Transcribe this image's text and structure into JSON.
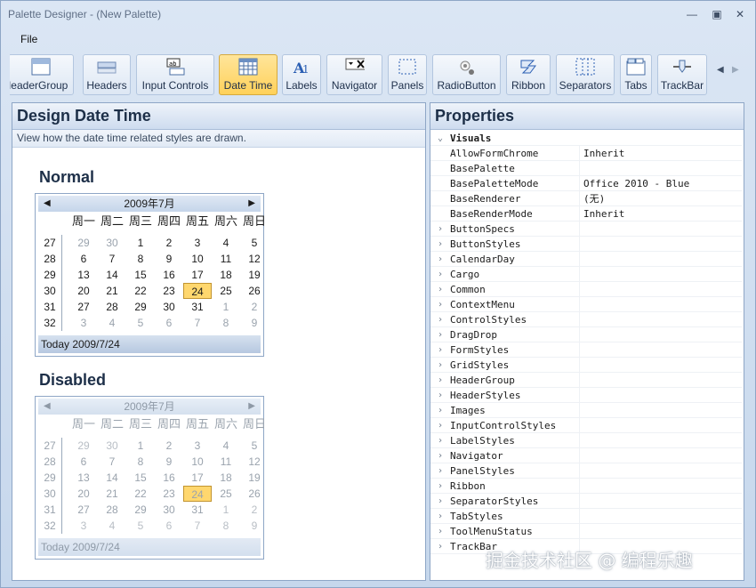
{
  "window": {
    "title": "Palette Designer - (New Palette)",
    "controls": [
      "minimize-icon",
      "restore-icon",
      "close-icon"
    ]
  },
  "menu": {
    "file": "File"
  },
  "toolbar": {
    "buttons": [
      {
        "label": "HeaderGroup",
        "icon": "header-group-icon"
      },
      {
        "label": "Headers",
        "icon": "headers-icon"
      },
      {
        "label": "Input Controls",
        "icon": "input-controls-icon"
      },
      {
        "label": "Date Time",
        "icon": "date-time-icon",
        "active": true
      },
      {
        "label": "Labels",
        "icon": "labels-icon"
      },
      {
        "label": "Navigator",
        "icon": "navigator-icon"
      },
      {
        "label": "Panels",
        "icon": "panels-icon"
      },
      {
        "label": "RadioButton",
        "icon": "radio-button-icon"
      },
      {
        "label": "Ribbon",
        "icon": "ribbon-icon"
      },
      {
        "label": "Separators",
        "icon": "separators-icon"
      },
      {
        "label": "Tabs",
        "icon": "tabs-icon"
      },
      {
        "label": "TrackBar",
        "icon": "trackbar-icon"
      }
    ]
  },
  "design": {
    "title": "Design Date Time",
    "subtitle": "View how the date time related styles are drawn.",
    "normal_title": "Normal",
    "disabled_title": "Disabled",
    "calendar": {
      "month": "2009年7月",
      "day_names": [
        "周一",
        "周二",
        "周三",
        "周四",
        "周五",
        "周六",
        "周日"
      ],
      "week_numbers": [
        "27",
        "28",
        "29",
        "30",
        "31",
        "32"
      ],
      "days": [
        [
          "29",
          "30",
          "1",
          "2",
          "3",
          "4",
          "5"
        ],
        [
          "6",
          "7",
          "8",
          "9",
          "10",
          "11",
          "12"
        ],
        [
          "13",
          "14",
          "15",
          "16",
          "17",
          "18",
          "19"
        ],
        [
          "20",
          "21",
          "22",
          "23",
          "24",
          "25",
          "26"
        ],
        [
          "27",
          "28",
          "29",
          "30",
          "31",
          "1",
          "2"
        ],
        [
          "3",
          "4",
          "5",
          "6",
          "7",
          "8",
          "9"
        ]
      ],
      "today_label": "Today 2009/7/24"
    }
  },
  "properties": {
    "title": "Properties",
    "rows": [
      {
        "name": "Visuals",
        "value": "",
        "category": true,
        "expanded": true
      },
      {
        "name": "AllowFormChrome",
        "value": "Inherit"
      },
      {
        "name": "BasePalette",
        "value": ""
      },
      {
        "name": "BasePaletteMode",
        "value": "Office 2010 - Blue"
      },
      {
        "name": "BaseRenderer",
        "value": "(无)"
      },
      {
        "name": "BaseRenderMode",
        "value": "Inherit"
      },
      {
        "name": "ButtonSpecs",
        "value": "",
        "collapsed": true
      },
      {
        "name": "ButtonStyles",
        "value": "",
        "collapsed": true
      },
      {
        "name": "CalendarDay",
        "value": "",
        "collapsed": true
      },
      {
        "name": "Cargo",
        "value": "",
        "collapsed": true
      },
      {
        "name": "Common",
        "value": "",
        "collapsed": true
      },
      {
        "name": "ContextMenu",
        "value": "",
        "collapsed": true
      },
      {
        "name": "ControlStyles",
        "value": "",
        "collapsed": true
      },
      {
        "name": "DragDrop",
        "value": "",
        "collapsed": true
      },
      {
        "name": "FormStyles",
        "value": "",
        "collapsed": true
      },
      {
        "name": "GridStyles",
        "value": "",
        "collapsed": true
      },
      {
        "name": "HeaderGroup",
        "value": "",
        "collapsed": true
      },
      {
        "name": "HeaderStyles",
        "value": "",
        "collapsed": true
      },
      {
        "name": "Images",
        "value": "",
        "collapsed": true
      },
      {
        "name": "InputControlStyles",
        "value": "",
        "collapsed": true
      },
      {
        "name": "LabelStyles",
        "value": "",
        "collapsed": true
      },
      {
        "name": "Navigator",
        "value": "",
        "collapsed": true
      },
      {
        "name": "PanelStyles",
        "value": "",
        "collapsed": true
      },
      {
        "name": "Ribbon",
        "value": "",
        "collapsed": true
      },
      {
        "name": "SeparatorStyles",
        "value": "",
        "collapsed": true
      },
      {
        "name": "TabStyles",
        "value": "",
        "collapsed": true
      },
      {
        "name": "ToolMenuStatus",
        "value": "",
        "collapsed": true
      },
      {
        "name": "TrackBar",
        "value": "",
        "collapsed": true
      }
    ]
  },
  "watermark": "掘金技术社区 @ 编程乐趣"
}
